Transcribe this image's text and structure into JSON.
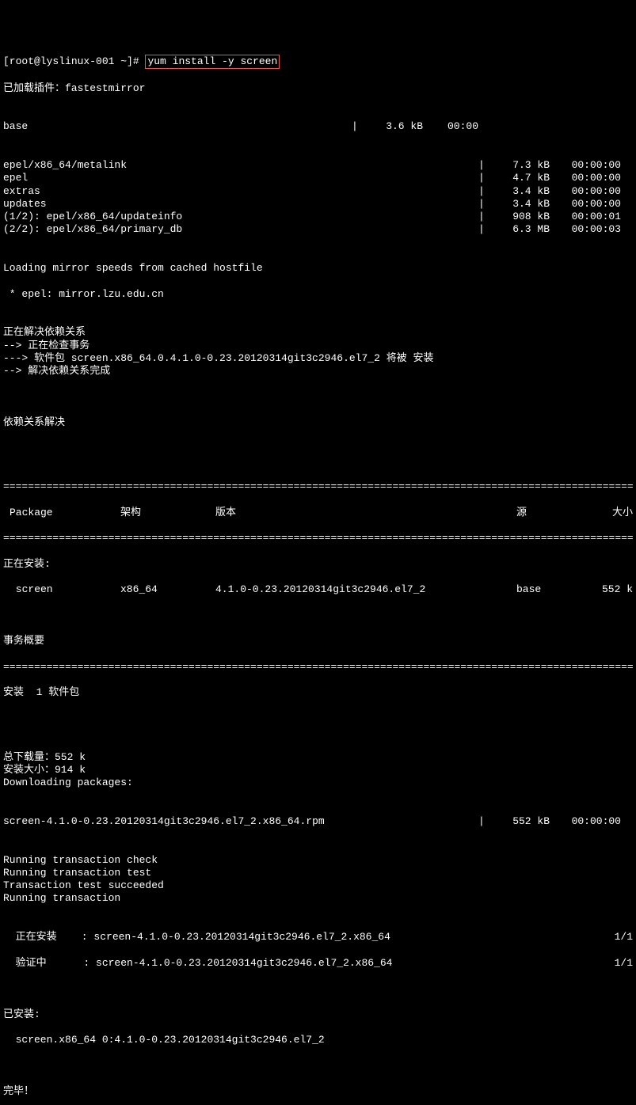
{
  "prompt": {
    "prefix": "[root@lyslinux-001 ~]# ",
    "cmd": "yum install -y screen"
  },
  "plugins_line": "已加载插件：fastestmirror",
  "repo_base": {
    "name": "base",
    "pipe": "|",
    "size": "3.6 kB",
    "time": "00:00"
  },
  "repos_right": [
    {
      "name": "epel/x86_64/metalink",
      "pipe": "|",
      "size": "7.3 kB",
      "time": "00:00:00"
    },
    {
      "name": "epel",
      "pipe": "|",
      "size": "4.7 kB",
      "time": "00:00:00"
    },
    {
      "name": "extras",
      "pipe": "|",
      "size": "3.4 kB",
      "time": "00:00:00"
    },
    {
      "name": "updates",
      "pipe": "|",
      "size": "3.4 kB",
      "time": "00:00:00"
    },
    {
      "name": "(1/2): epel/x86_64/updateinfo",
      "pipe": "|",
      "size": "908 kB",
      "time": "00:00:01"
    },
    {
      "name": "(2/2): epel/x86_64/primary_db",
      "pipe": "|",
      "size": "6.3 MB",
      "time": "00:00:03"
    }
  ],
  "loading_mirror": "Loading mirror speeds from cached hostfile",
  "epel_mirror": " * epel: mirror.lzu.edu.cn",
  "dep_lines": [
    "正在解决依赖关系",
    "--> 正在检查事务",
    "---> 软件包 screen.x86_64.0.4.1.0-0.23.20120314git3c2946.el7_2 将被 安装",
    "--> 解决依赖关系完成"
  ],
  "dep_resolved": "依赖关系解决",
  "hdr": {
    "package": "Package",
    "arch": "架构",
    "version": "版本",
    "repo": "源",
    "size": "大小"
  },
  "installing_label": "正在安装:",
  "pkg_row": {
    "name": " screen",
    "arch": "x86_64",
    "version": "4.1.0-0.23.20120314git3c2946.el7_2",
    "repo": "base",
    "size": "552 k"
  },
  "txn_summary": "事务概要",
  "install_count": "安装  1 软件包",
  "totals": [
    "总下载量：552 k",
    "安装大小：914 k",
    "Downloading packages:"
  ],
  "download_row": {
    "name": "screen-4.1.0-0.23.20120314git3c2946.el7_2.x86_64.rpm",
    "pipe": "|",
    "size": "552 kB",
    "time": "00:00:00"
  },
  "txn_lines": [
    "Running transaction check",
    "Running transaction test",
    "Transaction test succeeded",
    "Running transaction"
  ],
  "install_step": {
    "label": "  正在安装    : screen-4.1.0-0.23.20120314git3c2946.el7_2.x86_64",
    "progress": "1/1"
  },
  "verify_step": {
    "label": "  验证中      : screen-4.1.0-0.23.20120314git3c2946.el7_2.x86_64",
    "progress": "1/1"
  },
  "installed_label": "已安装:",
  "installed_pkg": "  screen.x86_64 0:4.1.0-0.23.20120314git3c2946.el7_2",
  "complete": "完毕！",
  "divider_eq": "=========================================================================================================",
  "divider_dash": "---------------------------------------------------------------------------------------------------------"
}
